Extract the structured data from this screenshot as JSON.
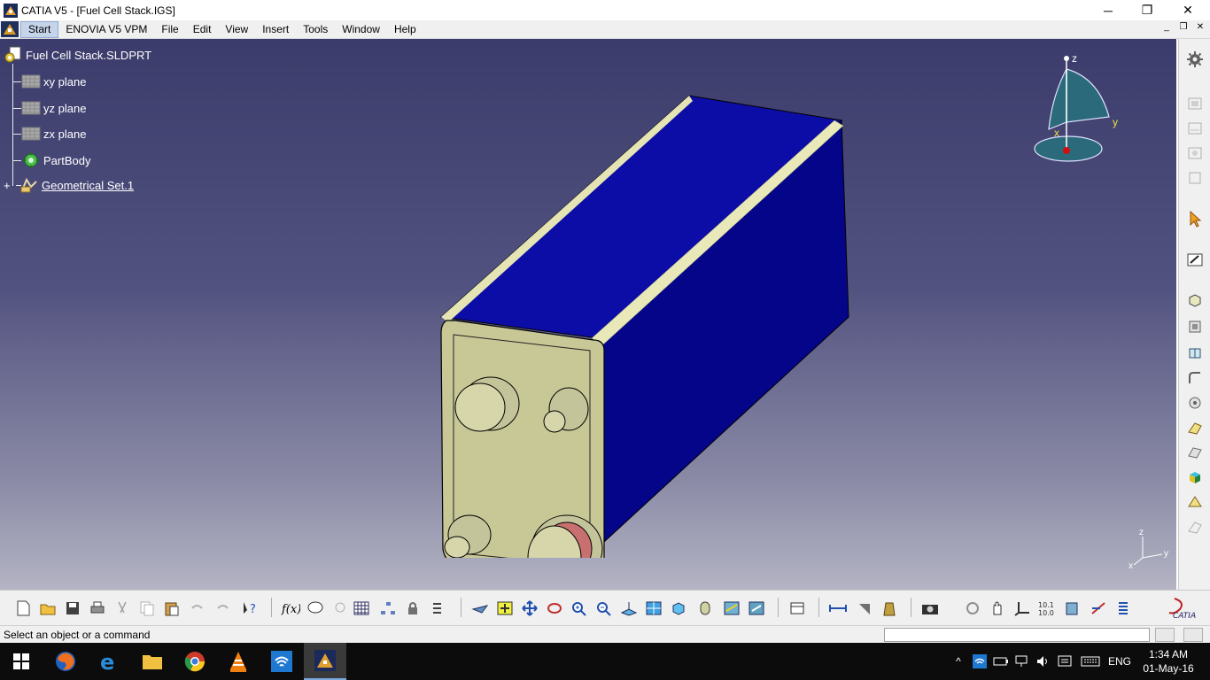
{
  "window": {
    "title": "CATIA V5 - [Fuel Cell Stack.IGS]",
    "minimize_glyph": "─",
    "maximize_glyph": "❐",
    "close_glyph": "✕"
  },
  "menubar": {
    "items": [
      "Start",
      "ENOVIA V5 VPM",
      "File",
      "Edit",
      "View",
      "Insert",
      "Tools",
      "Window",
      "Help"
    ],
    "doc_min_glyph": "_",
    "doc_restore_glyph": "❐",
    "doc_close_glyph": "✕"
  },
  "tree": {
    "root": "Fuel Cell Stack.SLDPRT",
    "items": [
      {
        "label": "xy plane",
        "icon": "plane-icon"
      },
      {
        "label": "yz plane",
        "icon": "plane-icon"
      },
      {
        "label": "zx plane",
        "icon": "plane-icon"
      },
      {
        "label": "PartBody",
        "icon": "partbody-icon"
      },
      {
        "label": "Geometrical Set.1",
        "icon": "geometrical-set-icon"
      }
    ]
  },
  "compass": {
    "z": "z",
    "x": "x",
    "y": "y"
  },
  "axis_triad": {
    "z": "z",
    "x": "x",
    "y": "y"
  },
  "status": {
    "message": "Select an object or a command"
  },
  "taskbar": {
    "apps": [
      "start-icon",
      "firefox-icon",
      "edge-icon",
      "file-explorer-icon",
      "chrome-icon",
      "vlc-icon",
      "wifi-app-icon",
      "catia-icon"
    ],
    "language": "ENG",
    "time": "1:34 AM",
    "date": "01-May-16"
  },
  "colors": {
    "viewport_top": "#3c3c6c",
    "viewport_bottom": "#b4b4c4",
    "stack_blue": "#0a0a9a",
    "endplate": "#c8c896",
    "tree_text": "#ffffff"
  }
}
